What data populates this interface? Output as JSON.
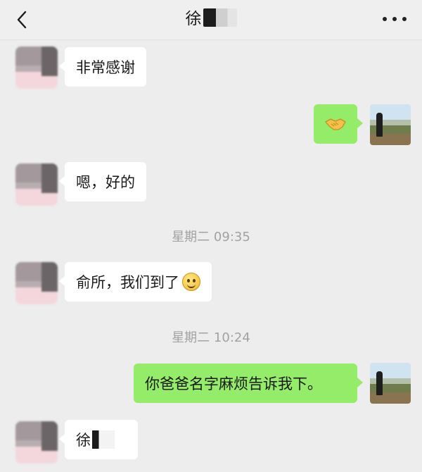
{
  "header": {
    "back_icon": "chevron-left-icon",
    "title": "徐",
    "more_icon": "more-dots-icon"
  },
  "messages": [
    {
      "side": "in",
      "text": "非常感谢"
    },
    {
      "side": "out",
      "icon": "handshake-emoji"
    },
    {
      "side": "in",
      "text": "嗯，好的"
    },
    {
      "side": "in",
      "text": "俞所，我们到了",
      "icon": "smile-emoji"
    },
    {
      "side": "out",
      "text": "你爸爸名字麻烦告诉我下。"
    },
    {
      "side": "in",
      "text": "徐"
    }
  ],
  "timestamps": [
    "星期二 09:35",
    "星期二 10:24"
  ],
  "colors": {
    "background": "#ededed",
    "bubble_in": "#ffffff",
    "bubble_out": "#95ec69",
    "timestamp": "#a2a2a2"
  }
}
